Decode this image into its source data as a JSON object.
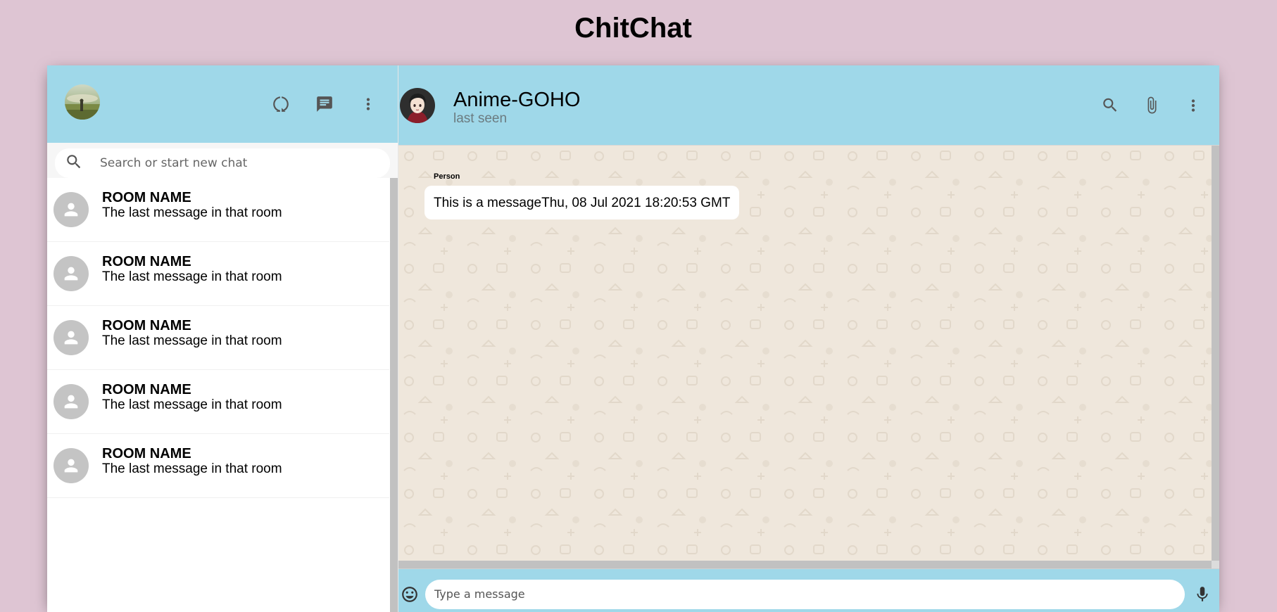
{
  "app": {
    "title": "ChitChat"
  },
  "sidebar": {
    "search": {
      "placeholder": "Search or start new chat"
    },
    "rooms": [
      {
        "name": "ROOM NAME",
        "last_message": "The last message in that room"
      },
      {
        "name": "ROOM NAME",
        "last_message": "The last message in that room"
      },
      {
        "name": "ROOM NAME",
        "last_message": "The last message in that room"
      },
      {
        "name": "ROOM NAME",
        "last_message": "The last message in that room"
      },
      {
        "name": "ROOM NAME",
        "last_message": "The last message in that room"
      }
    ],
    "header_icons": [
      "status-icon",
      "new-chat-icon",
      "more-vert-icon"
    ]
  },
  "chat": {
    "contact_name": "Anime-GOHO",
    "contact_status": "last seen",
    "header_icons": [
      "search-icon",
      "attach-icon",
      "more-vert-icon"
    ],
    "messages": [
      {
        "sender": "Person",
        "text": "This is a message",
        "timestamp": "Thu, 08 Jul 2021 18:20:53 GMT"
      }
    ],
    "input": {
      "placeholder": "Type a message"
    }
  },
  "colors": {
    "page_background": "#dec5d3",
    "header_background": "#9fd8e9",
    "chat_background": "#efe7dc",
    "bubble": "#ffffff"
  }
}
